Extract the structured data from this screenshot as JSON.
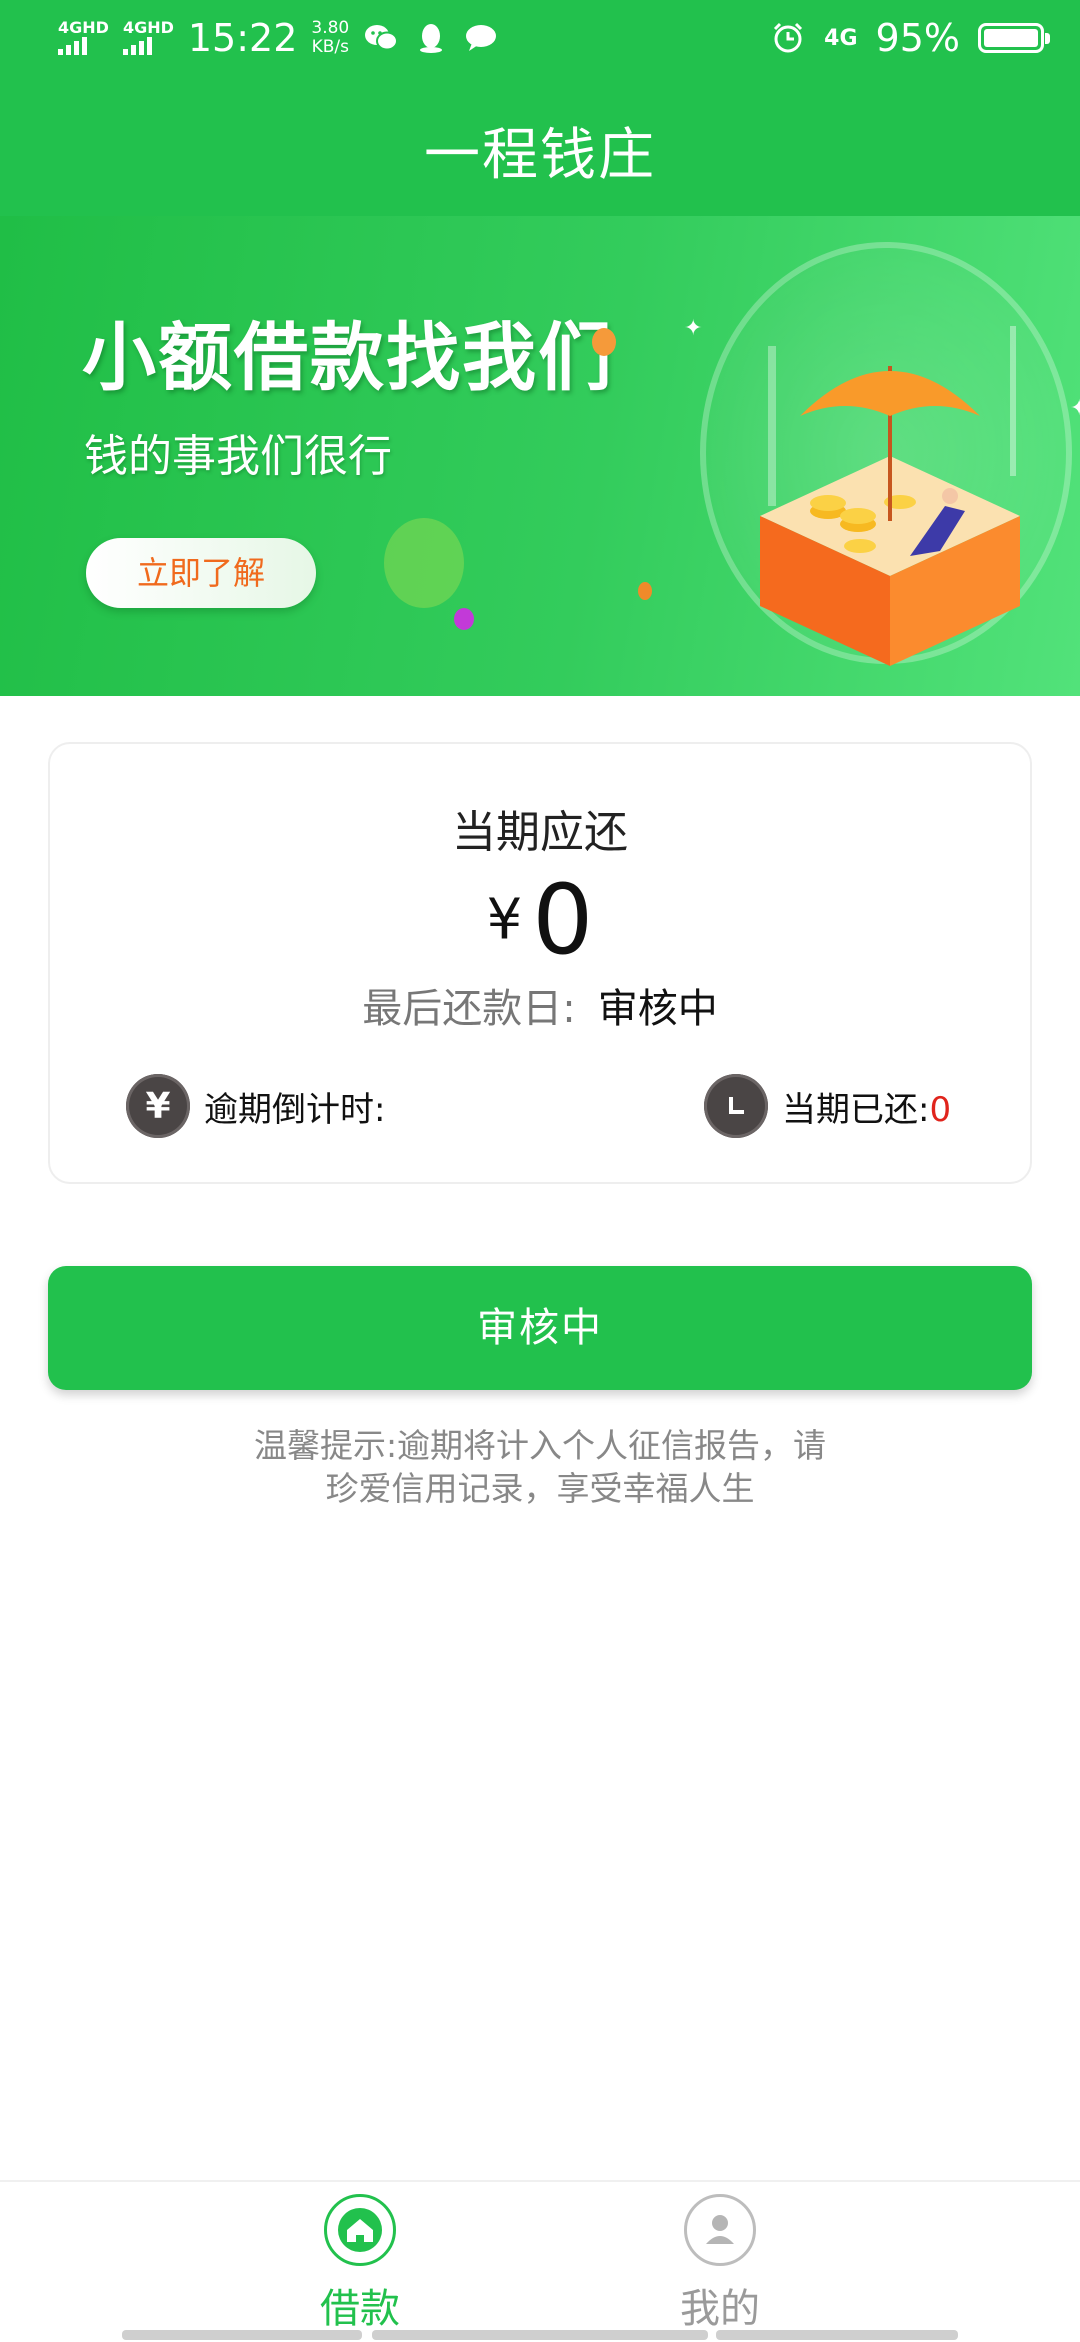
{
  "status": {
    "network1": "4GHD",
    "network2": "4GHD",
    "time": "15:22",
    "speed_value": "3.80",
    "speed_unit": "KB/s",
    "net_type": "4G",
    "battery": "95%"
  },
  "header": {
    "title": "一程钱庄"
  },
  "banner": {
    "headline": "小额借款找我们",
    "subtitle": "钱的事我们很行",
    "button": "立即了解"
  },
  "card": {
    "label": "当期应还",
    "currency": "¥",
    "amount": "0",
    "due_label": "最后还款日:",
    "due_value": "审核中",
    "overdue_label": "逾期倒计时:",
    "paid_label": "当期已还:",
    "paid_value": "0"
  },
  "main_button": "审核中",
  "tip": {
    "line1": "温馨提示:逾期将计入个人征信报告，请",
    "line2": "珍爱信用记录，享受幸福人生"
  },
  "nav": {
    "items": [
      {
        "label": "借款",
        "icon": "home-icon",
        "active": true
      },
      {
        "label": "我的",
        "icon": "user-icon",
        "active": false
      }
    ]
  },
  "colors": {
    "accent": "#22c14d",
    "inactive": "#9a9a9a",
    "warning_text": "#e0241c",
    "banner_button_text": "#f06a1d"
  }
}
